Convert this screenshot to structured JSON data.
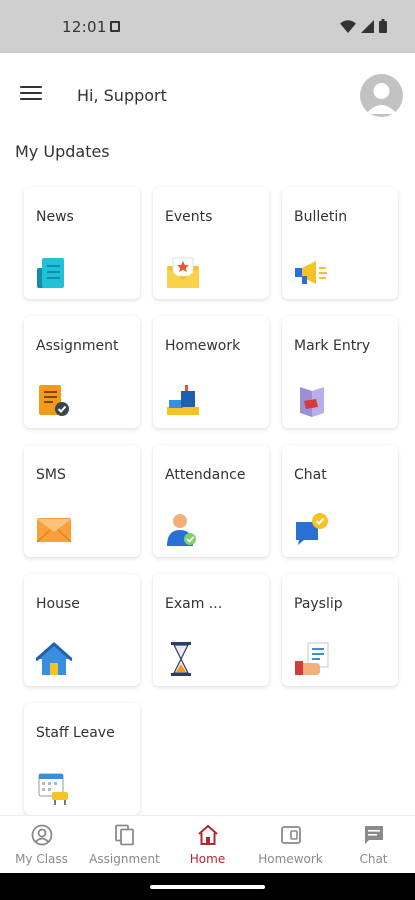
{
  "status_bar": {
    "time": "12:01"
  },
  "header": {
    "greeting": "Hi, Support"
  },
  "section": {
    "title": "My Updates"
  },
  "tiles": [
    {
      "label": "News",
      "icon": "news-icon"
    },
    {
      "label": "Events",
      "icon": "events-icon"
    },
    {
      "label": "Bulletin",
      "icon": "bulletin-icon"
    },
    {
      "label": "Assignment",
      "icon": "assignment-icon"
    },
    {
      "label": "Homework",
      "icon": "homework-icon"
    },
    {
      "label": "Mark Entry",
      "icon": "mark-entry-icon"
    },
    {
      "label": "SMS",
      "icon": "sms-icon"
    },
    {
      "label": "Attendance",
      "icon": "attendance-icon"
    },
    {
      "label": "Chat",
      "icon": "chat-icon"
    },
    {
      "label": "House",
      "icon": "house-icon"
    },
    {
      "label": "Exam ...",
      "icon": "exam-icon"
    },
    {
      "label": "Payslip",
      "icon": "payslip-icon"
    },
    {
      "label": "Staff Leave",
      "icon": "staff-leave-icon"
    }
  ],
  "bottom_nav": [
    {
      "label": "My Class",
      "icon": "my-class-icon",
      "active": false
    },
    {
      "label": "Assignment",
      "icon": "assignment-nav-icon",
      "active": false
    },
    {
      "label": "Home",
      "icon": "home-icon",
      "active": true
    },
    {
      "label": "Homework",
      "icon": "homework-nav-icon",
      "active": false
    },
    {
      "label": "Chat",
      "icon": "chat-nav-icon",
      "active": false
    }
  ],
  "colors": {
    "accent": "#b3262e",
    "status_bar": "#cfcfcf",
    "text": "#333333",
    "nav_inactive": "#8a8a8a"
  }
}
